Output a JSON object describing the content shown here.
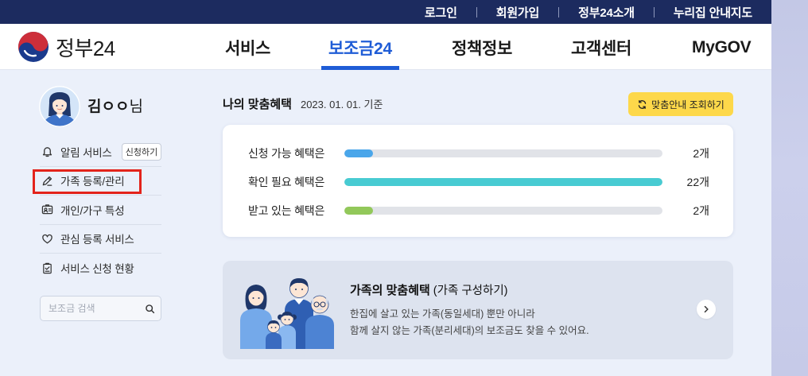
{
  "colors": {
    "navy": "#1c2b5f",
    "accent": "#1f5cd6",
    "highlight": "#e3231b",
    "yellow": "#fdd84a"
  },
  "top_bar": {
    "links": [
      {
        "label": "로그인"
      },
      {
        "label": "회원가입"
      },
      {
        "label": "정부24소개"
      },
      {
        "label": "누리집 안내지도"
      }
    ]
  },
  "header": {
    "logo_text": "정부24",
    "nav": [
      {
        "label": "서비스",
        "active": false
      },
      {
        "label": "보조금24",
        "active": true
      },
      {
        "label": "정책정보",
        "active": false
      },
      {
        "label": "고객센터",
        "active": false
      },
      {
        "label": "MyGOV",
        "active": false
      }
    ]
  },
  "sidebar": {
    "user": {
      "name": "김ㅇㅇ",
      "suffix": "님"
    },
    "menu": [
      {
        "icon": "bell-icon",
        "label": "알림 서비스",
        "button": "신청하기"
      },
      {
        "icon": "pencil-icon",
        "label": "가족 등록/관리",
        "highlighted": true
      },
      {
        "icon": "id-card-icon",
        "label": "개인/가구 특성"
      },
      {
        "icon": "heart-icon",
        "label": "관심 등록 서비스"
      },
      {
        "icon": "document-check-icon",
        "label": "서비스 신청 현황"
      }
    ],
    "search": {
      "placeholder": "보조금 검색",
      "icon": "search-icon"
    }
  },
  "benefits": {
    "title": "나의 맞춤혜택",
    "date": "2023. 01. 01. 기준",
    "refresh_button": {
      "icon": "refresh-icon",
      "label": "맞춤안내 조회하기"
    },
    "rows": [
      {
        "label": "신청 가능 혜택은",
        "count": "2개",
        "level": 0.09,
        "color": "#4aa6ea"
      },
      {
        "label": "확인 필요 혜택은",
        "count": "22개",
        "level": 1.0,
        "color": "#48cbd2"
      },
      {
        "label": "받고 있는 혜택은",
        "count": "2개",
        "level": 0.09,
        "color": "#92c85a"
      }
    ]
  },
  "family": {
    "title": "가족의 맞춤혜택",
    "subtitle": "(가족 구성하기)",
    "lines": [
      "한집에 살고 있는 가족(동일세대) 뿐만 아니라",
      "함께 살지 않는 가족(분리세대)의 보조금도 찾을 수 있어요."
    ],
    "icon": "chevron-right-icon"
  }
}
